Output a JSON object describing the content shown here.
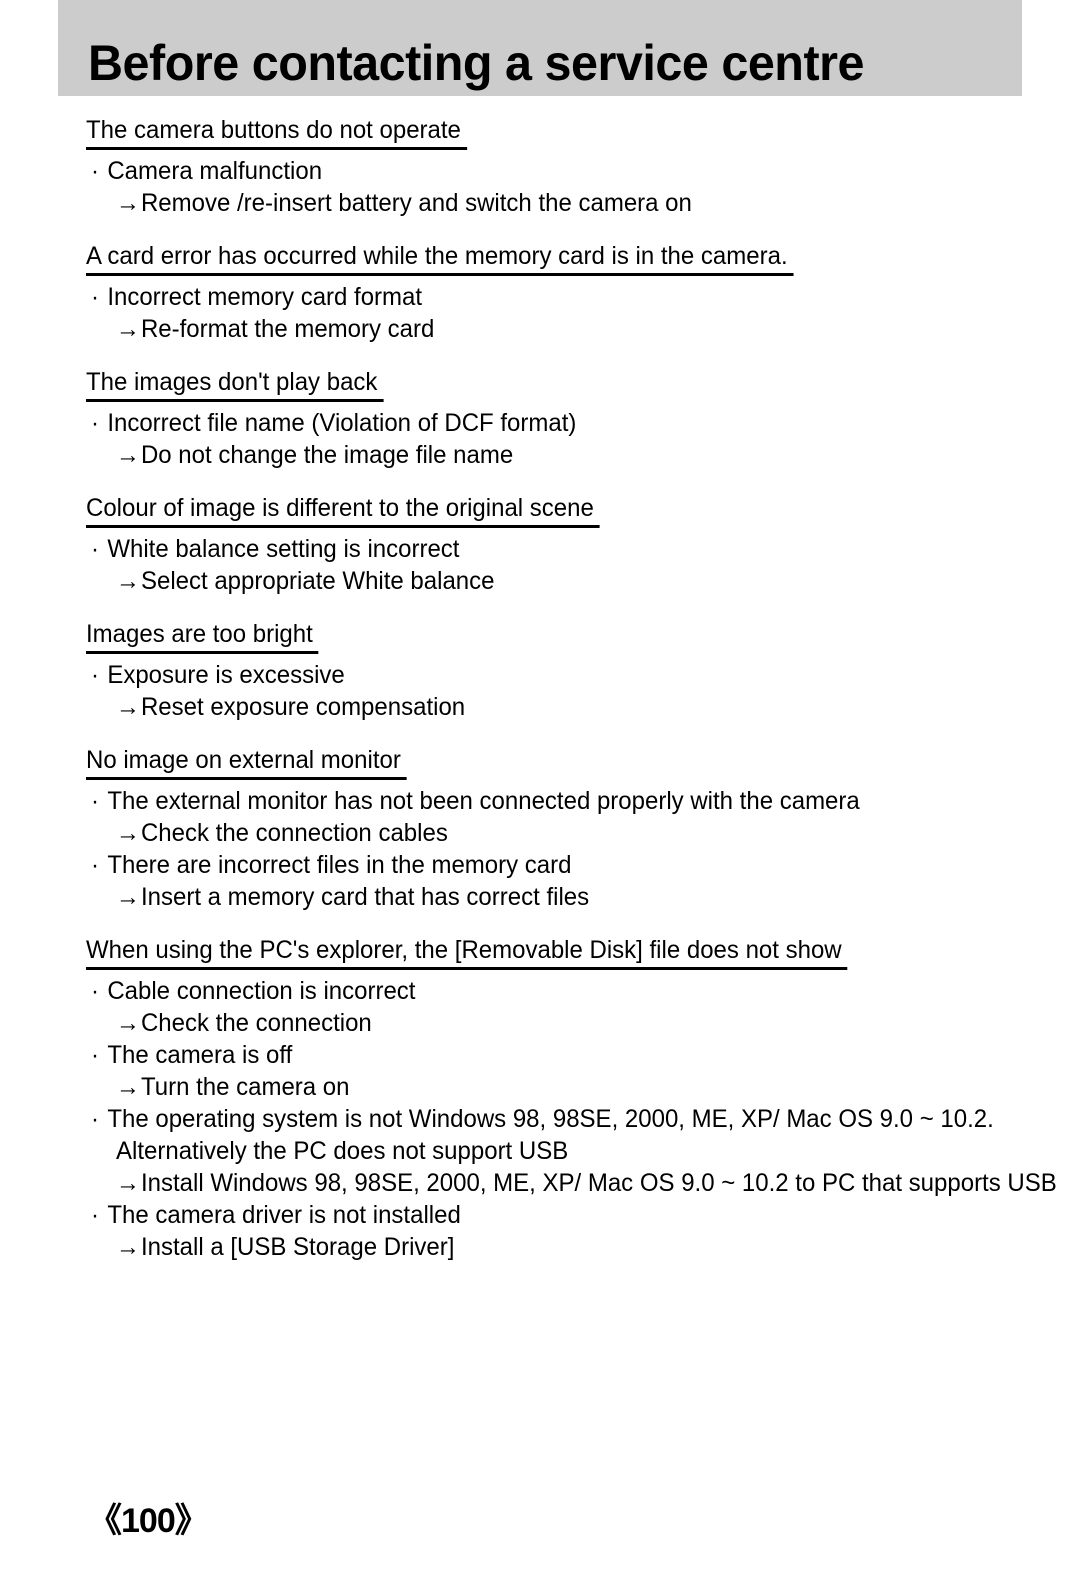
{
  "header": {
    "title": "Before contacting a service centre",
    "banner_color": "#cccccc"
  },
  "footer": {
    "page_number": "《100》"
  },
  "symbols": {
    "bullet": "·",
    "arrow": "→"
  },
  "sections": [
    {
      "heading": "The camera buttons do not operate",
      "items": [
        {
          "cause": "Camera malfunction",
          "remedy": "Remove /re-insert battery and switch the camera on"
        }
      ]
    },
    {
      "heading": "A card error has occurred while the memory card is in the camera.",
      "items": [
        {
          "cause": "Incorrect memory card format",
          "remedy": "Re-format the memory card"
        }
      ]
    },
    {
      "heading": "The images don't play back",
      "items": [
        {
          "cause": "Incorrect file name (Violation of DCF format)",
          "remedy": "Do not change the image file name"
        }
      ]
    },
    {
      "heading": "Colour of image is different to the original scene",
      "items": [
        {
          "cause": "White balance setting is incorrect",
          "remedy": "Select appropriate White balance"
        }
      ]
    },
    {
      "heading": "Images are too bright",
      "items": [
        {
          "cause": "Exposure is excessive",
          "remedy": "Reset exposure compensation"
        }
      ]
    },
    {
      "heading": "No image on external monitor",
      "items": [
        {
          "cause": "The external monitor has not been connected properly with the camera",
          "remedy": "Check the connection cables"
        },
        {
          "cause": "There are incorrect files in the memory card",
          "remedy": "Insert a memory card that has correct files"
        }
      ]
    },
    {
      "heading": "When using the PC's explorer, the [Removable Disk] file does not show",
      "items": [
        {
          "cause": "Cable connection is incorrect",
          "remedy": "Check the connection"
        },
        {
          "cause": "The camera is off",
          "remedy": "Turn the camera on"
        },
        {
          "cause": "The operating system is not Windows 98, 98SE, 2000, ME, XP/ Mac OS 9.0 ~ 10.2.",
          "cause_cont": "Alternatively the PC does not support USB",
          "remedy": "Install Windows 98, 98SE, 2000, ME, XP/ Mac OS 9.0 ~ 10.2 to PC that supports USB"
        },
        {
          "cause": "The camera driver is not installed",
          "remedy": "Install a [USB Storage Driver]"
        }
      ]
    }
  ]
}
